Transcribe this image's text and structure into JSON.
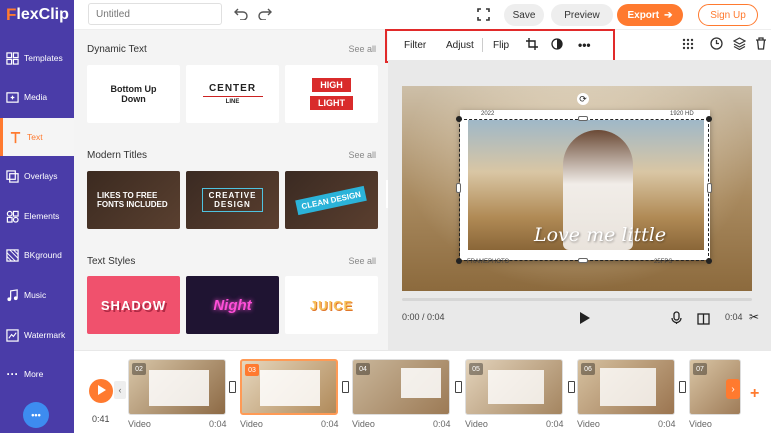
{
  "app": {
    "logo_f": "F",
    "logo_rest": "lexClip"
  },
  "topbar": {
    "title_placeholder": "Untitled",
    "save_label": "Save",
    "preview_label": "Preview",
    "export_label": "Export",
    "signup_label": "Sign Up"
  },
  "sidebar": {
    "items": [
      {
        "label": "Templates",
        "icon": "templates-icon"
      },
      {
        "label": "Media",
        "icon": "media-icon"
      },
      {
        "label": "Text",
        "icon": "text-icon",
        "active": true
      },
      {
        "label": "Overlays",
        "icon": "overlays-icon"
      },
      {
        "label": "Elements",
        "icon": "elements-icon"
      },
      {
        "label": "BKground",
        "icon": "background-icon"
      },
      {
        "label": "Music",
        "icon": "music-icon"
      },
      {
        "label": "Watermark",
        "icon": "watermark-icon"
      },
      {
        "label": "More",
        "icon": "more-icon"
      }
    ]
  },
  "panel": {
    "sections": [
      {
        "title": "Dynamic Text",
        "see_all": "See all",
        "items": [
          {
            "line1": "Bottom Up",
            "line2": "Down"
          },
          {
            "line1": "CENTER",
            "line2": "LINE"
          },
          {
            "line1": "HIGH",
            "line2": "LIGHT"
          }
        ]
      },
      {
        "title": "Modern Titles",
        "see_all": "See all",
        "items": [
          {
            "line1": "LIKES TO FREE",
            "line2": "FONTS INCLUDED"
          },
          {
            "line1": "CREATIVE",
            "line2": "DESIGN"
          },
          {
            "line1": "CLEAN DESIGN",
            "line2": ""
          }
        ]
      },
      {
        "title": "Text Styles",
        "see_all": "See all",
        "items": [
          {
            "line1": "SHADOW"
          },
          {
            "line1": "Night"
          },
          {
            "line1": "JUICE"
          }
        ]
      }
    ]
  },
  "toolbar": {
    "filter": "Filter",
    "adjust": "Adjust",
    "flip": "Flip"
  },
  "video": {
    "top_left": "2022",
    "top_right": "1920 HD",
    "bottom_left": "FRAMEPHOTO",
    "bottom_right": "25FPS",
    "overlay_text": "Love me little"
  },
  "player": {
    "current_time": "0:00 / 0:04",
    "clip_length": "0:04"
  },
  "timeline": {
    "total_time": "0:41",
    "clips": [
      {
        "num": "02",
        "label": "Video",
        "time": "0:04"
      },
      {
        "num": "03",
        "label": "Video",
        "time": "0:04",
        "active": true
      },
      {
        "num": "04",
        "label": "Video",
        "time": "0:04"
      },
      {
        "num": "05",
        "label": "Video",
        "time": "0:04"
      },
      {
        "num": "06",
        "label": "Video",
        "time": "0:04"
      },
      {
        "num": "07",
        "label": "Video",
        "time": ""
      }
    ]
  },
  "colors": {
    "sidebar": "#4a3ca8",
    "accent": "#ff7a2f",
    "highlight_box": "#e12a2a"
  }
}
